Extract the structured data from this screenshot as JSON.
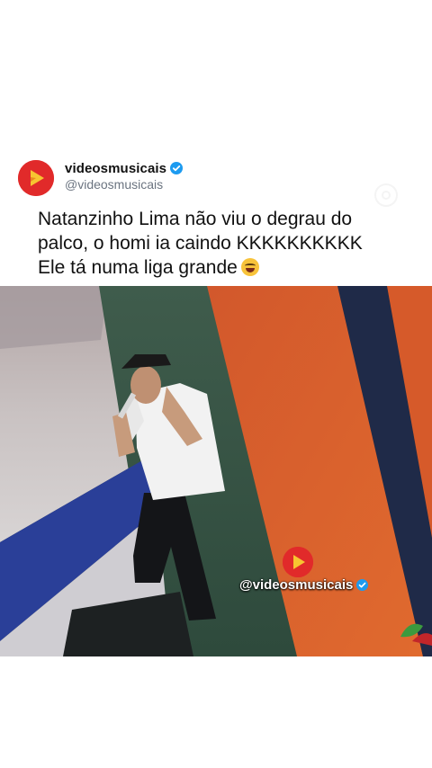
{
  "post": {
    "author": {
      "display_name": "videosmusicais",
      "handle": "@videosmusicais",
      "verified": true,
      "avatar_icon": "play-triangle-icon",
      "brand_color": "#e12a2a"
    },
    "caption_lines": [
      "Natanzinho Lima não viu o degrau do",
      "palco, o homi ia caindo KKKKKKKKKK",
      "Ele tá numa liga grande"
    ],
    "caption_emoji": "face-with-tears-of-joy-icon",
    "video": {
      "watermark_text": "@videosmusicais",
      "watermark_verified": true
    }
  },
  "colors": {
    "verified_blue": "#1d9bf0",
    "text_primary": "#111111",
    "text_secondary": "#6b7480"
  }
}
